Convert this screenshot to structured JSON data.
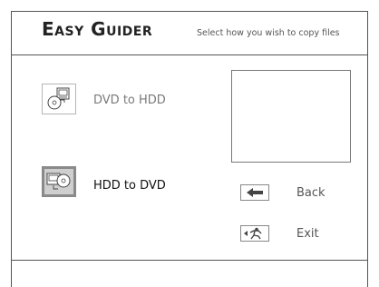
{
  "header": {
    "brand": "Easy Guider",
    "subtitle": "Select how you wish to copy files"
  },
  "options": [
    {
      "label": "DVD to HDD",
      "icon": "dvd-to-hdd-icon",
      "selected": false
    },
    {
      "label": "HDD to DVD",
      "icon": "hdd-to-dvd-icon",
      "selected": true
    }
  ],
  "actions": {
    "back_label": "Back",
    "back_icon": "left-arrow-icon",
    "exit_label": "Exit",
    "exit_icon": "exit-runner-icon"
  },
  "colors": {
    "frame": "#555555",
    "selected_fill": "#cfcfcf",
    "selected_border": "#8a8a8a"
  }
}
